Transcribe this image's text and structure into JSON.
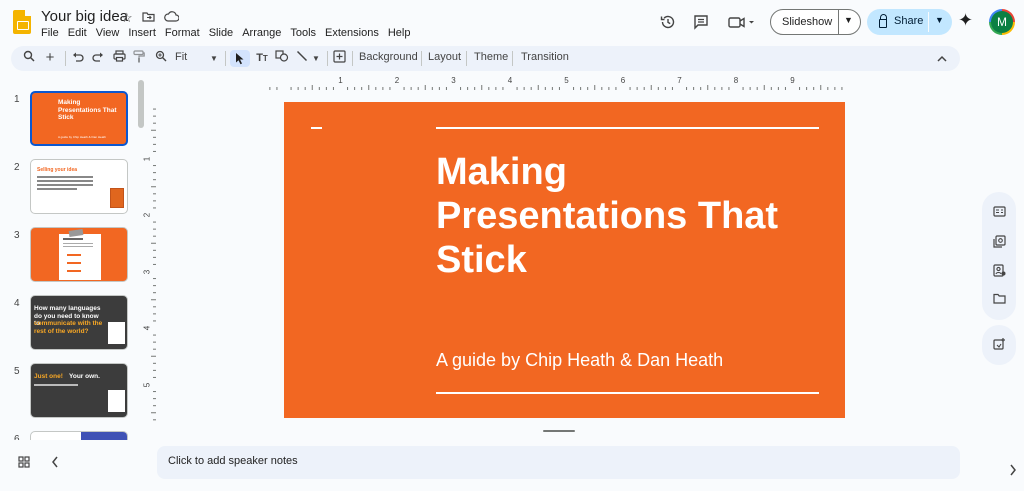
{
  "app": {
    "title": "Your big idea",
    "menu": [
      "File",
      "Edit",
      "View",
      "Insert",
      "Format",
      "Slide",
      "Arrange",
      "Tools",
      "Extensions",
      "Help"
    ],
    "slideshow_label": "Slideshow",
    "share_label": "Share",
    "avatar_letter": "M"
  },
  "toolbar": {
    "zoom": "Fit",
    "background": "Background",
    "layout": "Layout",
    "theme": "Theme",
    "transition": "Transition"
  },
  "ruler": {
    "top_ticks": [
      "1",
      "2",
      "3",
      "4",
      "5",
      "6",
      "7",
      "8",
      "9"
    ],
    "left_ticks": [
      "1",
      "2",
      "3",
      "4",
      "5"
    ]
  },
  "slides": [
    {
      "num": "1",
      "title": "Making Presentations That Stick",
      "sub": "A guide by Chip Heath & Dan Heath"
    },
    {
      "num": "2",
      "title": "Selling your idea"
    },
    {
      "num": "3",
      "title": ""
    },
    {
      "num": "4",
      "title_a": "How many languages do you need to know to",
      "title_b": "communicate with the rest of the world?"
    },
    {
      "num": "5",
      "title_a": "Just one!",
      "title_b": "Your own."
    },
    {
      "num": "6"
    }
  ],
  "current_slide": {
    "title": "Making Presentations That Stick",
    "subtitle": "A guide by Chip Heath & Dan Heath"
  },
  "notes": {
    "placeholder": "Click to add speaker notes"
  },
  "colors": {
    "slide_orange": "#f26722",
    "selected_blue": "#0b57d0",
    "share_bg": "#c2e7ff"
  }
}
